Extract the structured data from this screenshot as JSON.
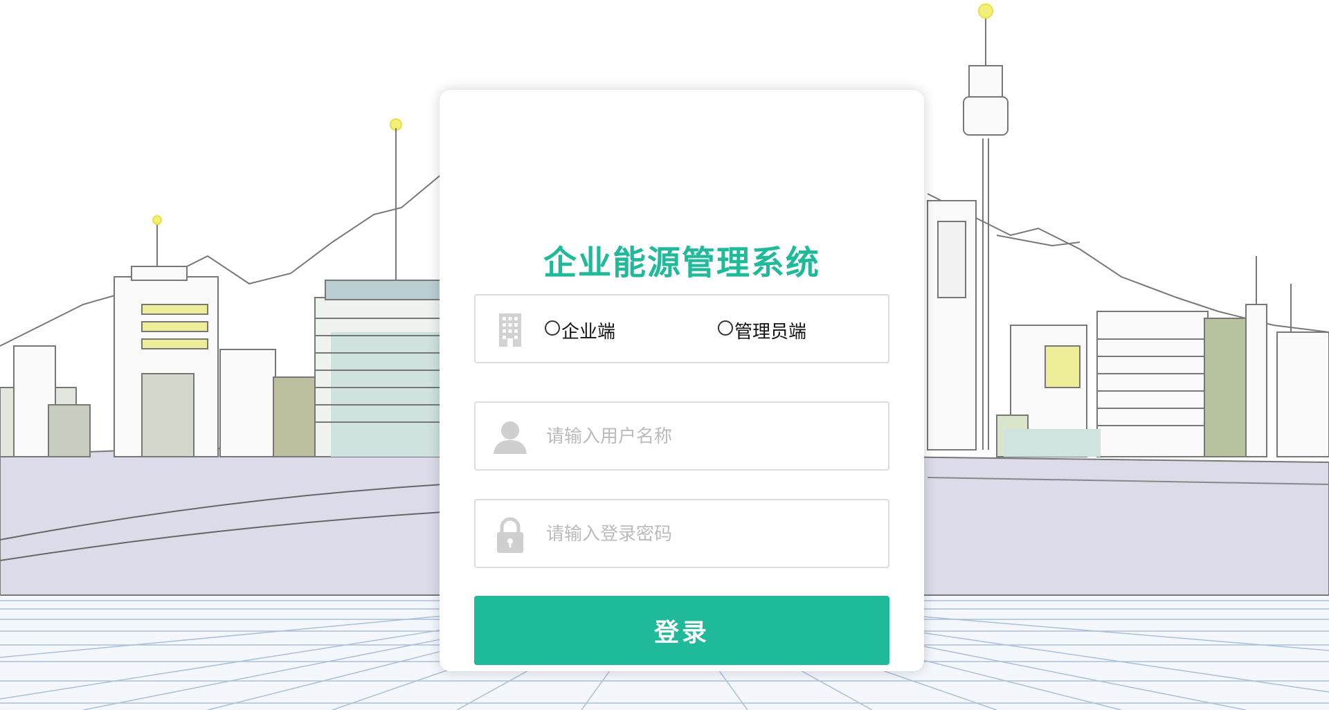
{
  "app": {
    "title": "企业能源管理系统"
  },
  "role_selector": {
    "icon": "building-icon",
    "options": [
      {
        "label": "企业端",
        "selected": false
      },
      {
        "label": "管理员端",
        "selected": false
      }
    ]
  },
  "username": {
    "icon": "user-icon",
    "value": "",
    "placeholder": "请输入用户名称"
  },
  "password": {
    "icon": "lock-icon",
    "value": "",
    "placeholder": "请输入登录密码"
  },
  "login_button": {
    "label": "登录"
  },
  "colors": {
    "accent": "#1fba99",
    "background": "#ffffff",
    "ground_grid": "#a9bfdc",
    "placeholder": "#bbbbbb",
    "icon": "#cccccc"
  }
}
